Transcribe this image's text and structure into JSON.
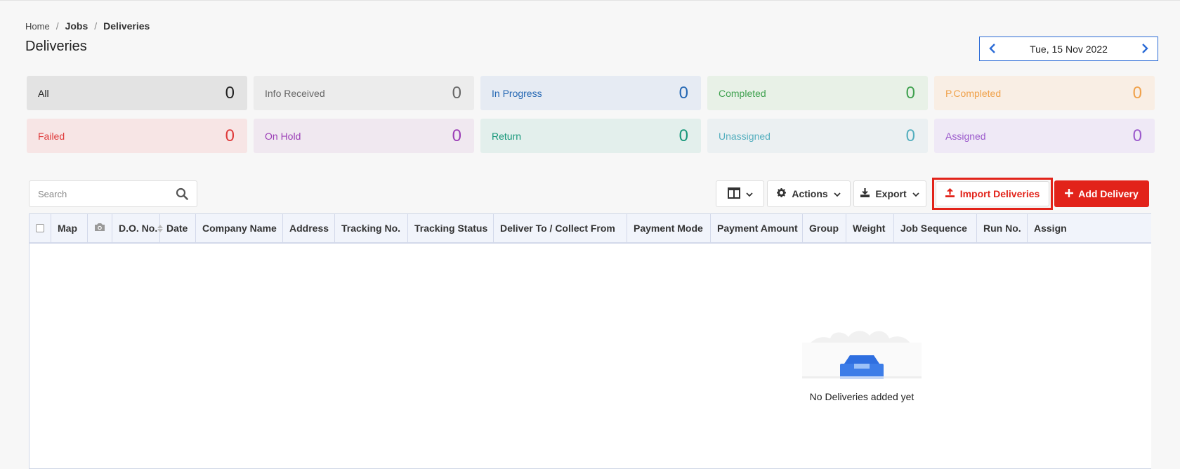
{
  "breadcrumb": {
    "home": "Home",
    "jobs": "Jobs",
    "current": "Deliveries",
    "separator": "/"
  },
  "page": {
    "title": "Deliveries"
  },
  "date_nav": {
    "date": "Tue, 15 Nov 2022"
  },
  "status_cards": [
    {
      "label": "All",
      "count": "0",
      "bg": "#e3e3e3",
      "color": "#222"
    },
    {
      "label": "Info Received",
      "count": "0",
      "bg": "#ececec",
      "color": "#666"
    },
    {
      "label": "In Progress",
      "count": "0",
      "bg": "#e6ebf3",
      "color": "#2467b3"
    },
    {
      "label": "Completed",
      "count": "0",
      "bg": "#e8f1e7",
      "color": "#3fa14f"
    },
    {
      "label": "P.Completed",
      "count": "0",
      "bg": "#f9eee4",
      "color": "#f0a14a"
    },
    {
      "label": "Failed",
      "count": "0",
      "bg": "#f7e5e5",
      "color": "#df3a3a"
    },
    {
      "label": "On Hold",
      "count": "0",
      "bg": "#f0e8f0",
      "color": "#9b3db6"
    },
    {
      "label": "Return",
      "count": "0",
      "bg": "#e3efec",
      "color": "#17977a"
    },
    {
      "label": "Unassigned",
      "count": "0",
      "bg": "#ebf0f2",
      "color": "#53aebe"
    },
    {
      "label": "Assigned",
      "count": "0",
      "bg": "#efe9f6",
      "color": "#9b59cc"
    }
  ],
  "search": {
    "placeholder": "Search"
  },
  "toolbar": {
    "actions_label": "Actions",
    "export_label": "Export",
    "import_label": "Import Deliveries",
    "add_label": "Add Delivery"
  },
  "table": {
    "columns": [
      "Map",
      "D.O. No.",
      "Date",
      "Company Name",
      "Address",
      "Tracking No.",
      "Tracking Status",
      "Deliver To / Collect From",
      "Payment Mode",
      "Payment Amount",
      "Group",
      "Weight",
      "Job Sequence",
      "Run No.",
      "Assign"
    ]
  },
  "empty_state": {
    "message": "No Deliveries added yet"
  },
  "colors": {
    "accent": "#e2231a",
    "link": "#2b6bd6",
    "header_bg": "#f1f4fb"
  }
}
